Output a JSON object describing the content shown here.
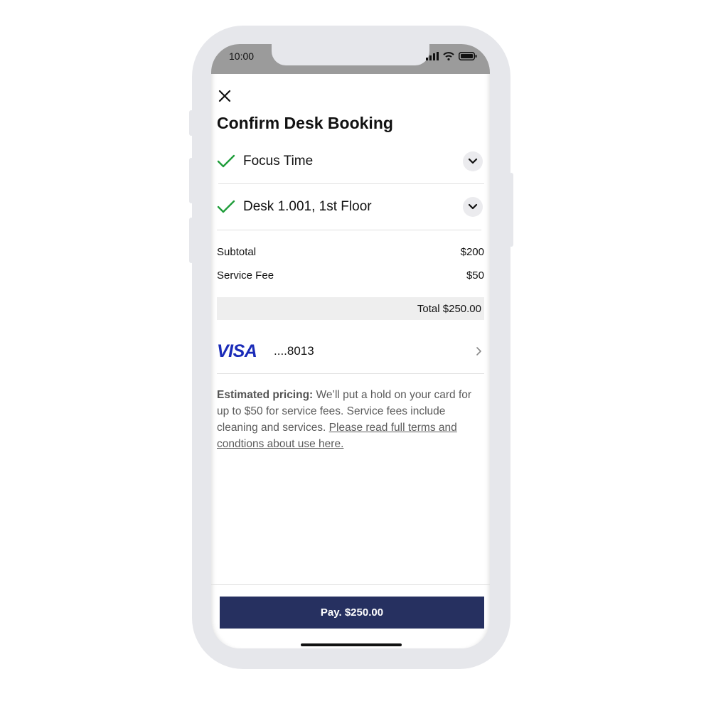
{
  "status_bar": {
    "time": "10:00"
  },
  "sheet": {
    "title": "Confirm Desk Booking",
    "selections": [
      {
        "label": "Focus Time",
        "icon": "check-icon",
        "expand_icon": "chevron-down-icon"
      },
      {
        "label": "Desk 1.001, 1st Floor",
        "icon": "check-icon",
        "expand_icon": "chevron-down-icon"
      }
    ],
    "pricing": {
      "subtotal_label": "Subtotal",
      "subtotal_value": "$200",
      "service_fee_label": "Service Fee",
      "service_fee_value": "$50",
      "total": "Total $250.00"
    },
    "payment_method": {
      "brand": "VISA",
      "card_number": "....8013"
    },
    "terms": {
      "bold_lead": "Estimated pricing:",
      "text": " We’ll put a hold on your card for up to $50 for service fees. Service fees include cleaning and services. ",
      "link": "Please read full terms and condtions about use here."
    },
    "pay_button": "Pay. $250.00"
  },
  "colors": {
    "check_green": "#1f9d3a",
    "pay_button_bg": "#263060",
    "visa_blue": "#1a2bb8",
    "status_bar_bg": "#9b9b9b",
    "phone_frame": "#e6e7eb"
  }
}
